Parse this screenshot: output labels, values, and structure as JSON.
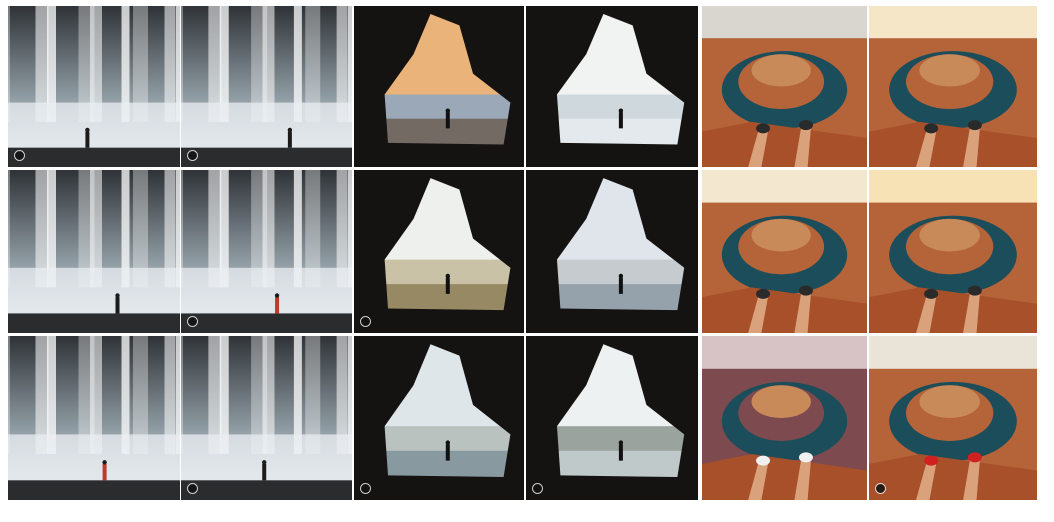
{
  "collage": {
    "columns": [
      {
        "group": "waterfall",
        "tiles": [
          {
            "scene": "waterfall",
            "figure_color": "#1b1b1b",
            "badge": true
          },
          {
            "scene": "waterfall",
            "figure_color": "#1b1b1b",
            "badge": false
          },
          {
            "scene": "waterfall",
            "figure_color": "#c0392b",
            "badge": false
          }
        ]
      },
      {
        "group": "waterfall",
        "tiles": [
          {
            "scene": "waterfall",
            "figure_color": "#1b1b1b",
            "badge": true
          },
          {
            "scene": "waterfall",
            "figure_color": "#c0392b",
            "badge": true
          },
          {
            "scene": "waterfall",
            "figure_color": "#1b1b1b",
            "badge": true
          }
        ]
      },
      {
        "group": "cave",
        "tiles": [
          {
            "scene": "cave-sunset",
            "badge": false
          },
          {
            "scene": "cave-landscape",
            "badge": true
          },
          {
            "scene": "cave-sea",
            "badge": true
          }
        ]
      },
      {
        "group": "cave",
        "tiles": [
          {
            "scene": "cave-snow",
            "badge": false
          },
          {
            "scene": "cave-mountain",
            "badge": false
          },
          {
            "scene": "cave-iceberg",
            "badge": true
          }
        ]
      },
      {
        "group": "canyon",
        "tiles": [
          {
            "scene": "canyon-feet",
            "badge": false
          },
          {
            "scene": "canyon-teal",
            "badge": false
          },
          {
            "scene": "canyon-dusk",
            "badge": false
          }
        ]
      },
      {
        "group": "canyon",
        "tiles": [
          {
            "scene": "canyon-sunrise",
            "badge": false
          },
          {
            "scene": "canyon-sunburst",
            "badge": false
          },
          {
            "scene": "canyon-redshoes",
            "badge": true
          }
        ]
      }
    ],
    "colors": {
      "waterfall_rock": "#2f3337",
      "waterfall_water": "#e9eef1",
      "mist": "#c9d3d8",
      "cave_rock": "#151312",
      "canyon_rock": "#b5643a",
      "river": "#1c4d5a",
      "sky": "#e7e2d8"
    }
  }
}
